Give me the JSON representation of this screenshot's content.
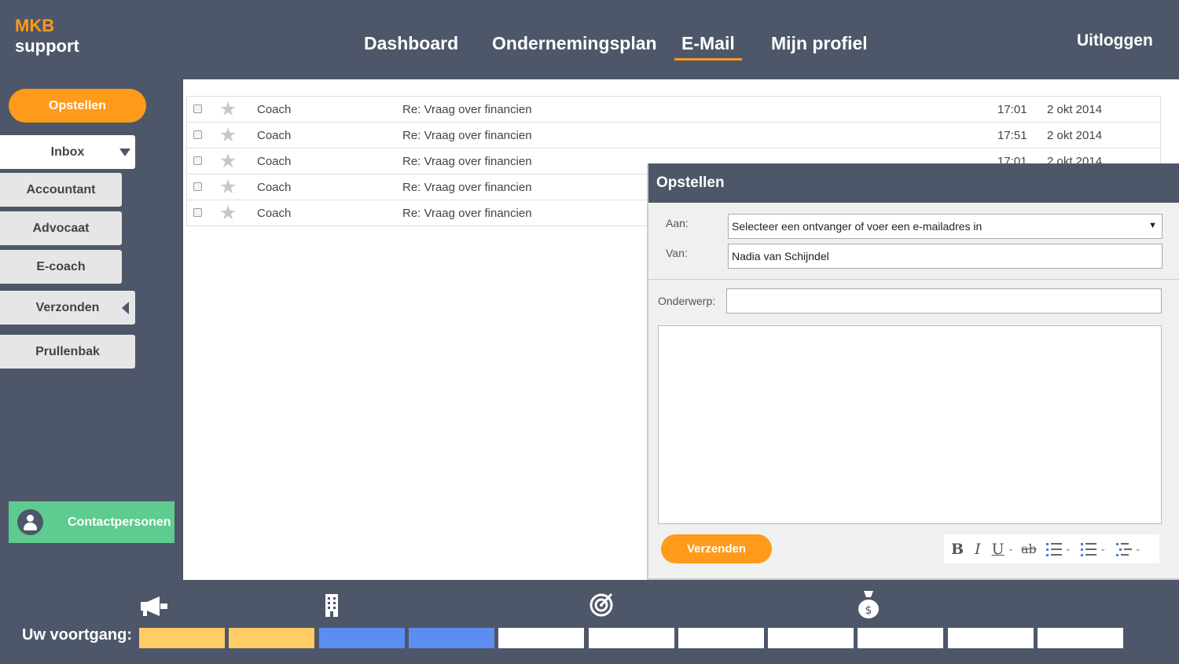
{
  "brand": {
    "line1": "MKB",
    "line2": "support"
  },
  "nav": {
    "items": [
      "Dashboard",
      "Ondernemingsplan",
      "E-Mail",
      "Mijn profiel"
    ],
    "active": "E-Mail",
    "logout": "Uitloggen"
  },
  "sidebar": {
    "compose": "Opstellen",
    "folders": [
      "Inbox",
      "Accountant",
      "Advocaat",
      "E-coach",
      "Verzonden",
      "Prullenbak"
    ],
    "contacts": "Contactpersonen"
  },
  "inbox": {
    "rows": [
      {
        "from": "Coach",
        "subject": "Re: Vraag over financien",
        "time": "17:01",
        "date": "2  okt 2014"
      },
      {
        "from": "Coach",
        "subject": "Re: Vraag over financien",
        "time": "17:51",
        "date": "2  okt 2014"
      },
      {
        "from": "Coach",
        "subject": "Re: Vraag over financien",
        "time": "17:01",
        "date": "2  okt 2014"
      },
      {
        "from": "Coach",
        "subject": "Re: Vraag over financien",
        "time": "",
        "date": ""
      },
      {
        "from": "Coach",
        "subject": "Re: Vraag over financien",
        "time": "",
        "date": ""
      }
    ]
  },
  "compose": {
    "title": "Opstellen",
    "to_label": "Aan:",
    "to_value": "Selecteer een ontvanger of voer een e-mailadres in",
    "from_label": "Van:",
    "from_value": "Nadia van Schijndel",
    "subject_label": "Onderwerp:",
    "subject_value": "",
    "body_value": "",
    "send": "Verzenden",
    "toolbar_icons": [
      "bold-icon",
      "italic-icon",
      "underline-icon",
      "strikethrough-icon",
      "bullet-list-icon",
      "numbered-list-icon",
      "indent-list-icon"
    ]
  },
  "progress": {
    "label": "Uw voortgang:",
    "segments": [
      "done",
      "done",
      "active",
      "active",
      "empty",
      "empty",
      "empty",
      "empty",
      "empty",
      "empty",
      "empty"
    ],
    "colors": {
      "done": "#ffcc66",
      "active": "#5b8ef0",
      "empty": "#ffffff"
    },
    "icons": [
      "megaphone-icon",
      "building-icon",
      "target-icon",
      "money-bag-icon"
    ]
  },
  "colors": {
    "accent": "#ff9a1a",
    "background": "#4d5769",
    "contacts": "#5ecb8f"
  }
}
